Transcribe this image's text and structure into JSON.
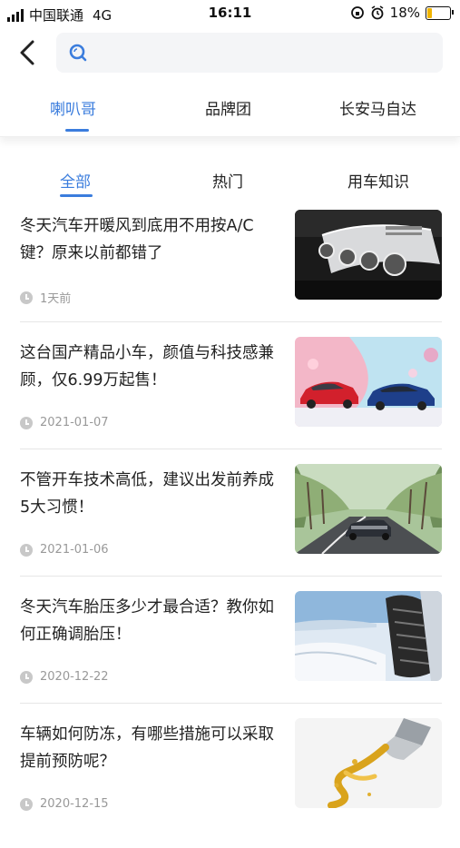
{
  "status_bar": {
    "carrier": "中国联通",
    "network": "4G",
    "time": "16:11",
    "battery": "18%"
  },
  "search": {
    "placeholder": "",
    "value": ""
  },
  "top_tabs": [
    {
      "label": "喇叭哥",
      "active": true
    },
    {
      "label": "品牌团",
      "active": false
    },
    {
      "label": "长安马自达",
      "active": false
    }
  ],
  "sub_tabs": [
    {
      "label": "全部",
      "active": true
    },
    {
      "label": "热门",
      "active": false
    },
    {
      "label": "用车知识",
      "active": false
    }
  ],
  "articles": [
    {
      "title": "冬天汽车开暖风到底用不用按A/C键？原来以前都错了",
      "date": "1天前",
      "image": "car-dashboard-vents"
    },
    {
      "title": "这台国产精品小车，颜值与科技感兼顾，仅6.99万起售！",
      "date": "2021-01-07",
      "image": "red-and-blue-cars"
    },
    {
      "title": "不管开车技术高低，建议出发前养成5大习惯！",
      "date": "2021-01-06",
      "image": "car-on-tree-lined-road"
    },
    {
      "title": "冬天汽车胎压多少才最合适？教你如何正确调胎压！",
      "date": "2020-12-22",
      "image": "snow-tire"
    },
    {
      "title": "车辆如何防冻，有哪些措施可以采取提前预防呢？",
      "date": "2020-12-15",
      "image": "oil-splash"
    }
  ],
  "colors": {
    "accent": "#3b7ddd",
    "battery_fill": "#f0b400",
    "meta_text": "#999999"
  }
}
